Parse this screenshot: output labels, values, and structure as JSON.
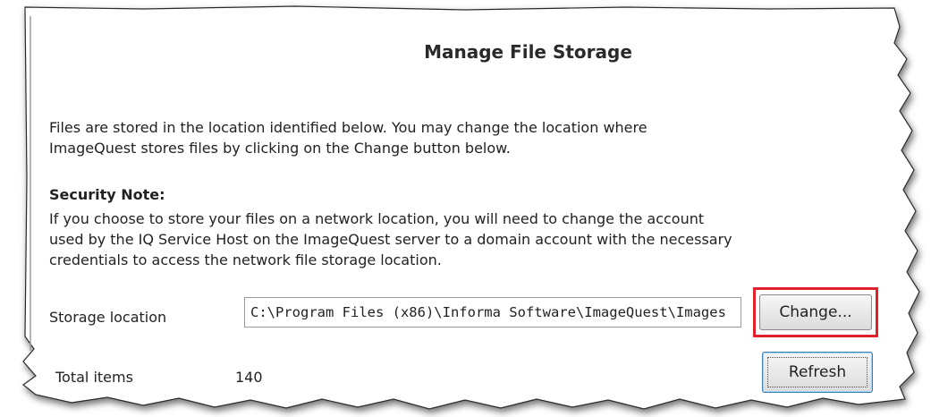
{
  "title": "Manage File Storage",
  "intro": {
    "line1": "Files are stored in the location identified below.  You may change the location where",
    "line2": "ImageQuest stores files by clicking on the Change button below."
  },
  "security_note": {
    "heading": "Security Note:",
    "line1": "If you choose to store your files on a network location, you will need to change the account",
    "line2": "used by the IQ Service Host on the ImageQuest server to a domain account with the necessary",
    "line3": "credentials to access the network file storage location."
  },
  "storage": {
    "label": "Storage location",
    "value": "C:\\Program Files (x86)\\Informa Software\\ImageQuest\\Images",
    "change_label": "Change..."
  },
  "totals": {
    "label": "Total items",
    "value": "140",
    "refresh_label": "Refresh"
  },
  "colors": {
    "highlight": "#e0202a",
    "focus_border": "#3c7fb1"
  }
}
